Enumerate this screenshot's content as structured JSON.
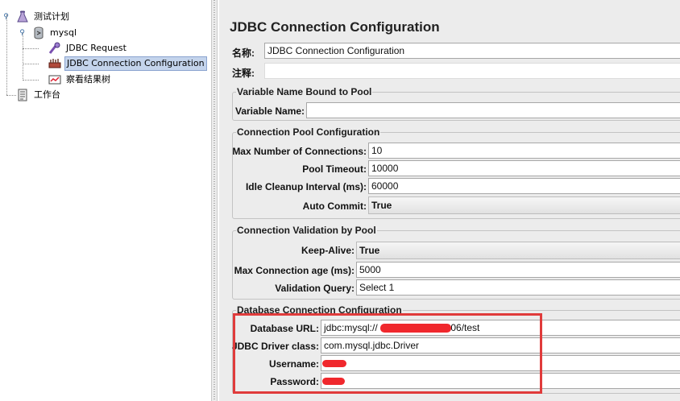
{
  "tree": {
    "items": [
      {
        "label": "测试计划",
        "icon": "test-plan-icon"
      },
      {
        "label": "mysql",
        "icon": "thread-group-icon"
      },
      {
        "label": "JDBC Request",
        "icon": "sampler-icon"
      },
      {
        "label": "JDBC Connection Configuration",
        "icon": "config-element-icon",
        "selected": true
      },
      {
        "label": "察看结果树",
        "icon": "listener-icon"
      },
      {
        "label": "工作台",
        "icon": "workbench-icon"
      }
    ]
  },
  "panel": {
    "title": "JDBC Connection Configuration",
    "name_label": "名称:",
    "name_value": "JDBC Connection Configuration",
    "comment_label": "注释:",
    "comment_value": "",
    "variable_group": {
      "title": "Variable Name Bound to Pool",
      "variable_name_label": "Variable Name:",
      "variable_name_value": ""
    },
    "pool_group": {
      "title": "Connection Pool Configuration",
      "max_connections_label": "Max Number of Connections:",
      "max_connections_value": "10",
      "pool_timeout_label": "Pool Timeout:",
      "pool_timeout_value": "10000",
      "idle_cleanup_label": "Idle Cleanup Interval (ms):",
      "idle_cleanup_value": "60000",
      "auto_commit_label": "Auto Commit:",
      "auto_commit_value": "True"
    },
    "validation_group": {
      "title": "Connection Validation by Pool",
      "keep_alive_label": "Keep-Alive:",
      "keep_alive_value": "True",
      "max_age_label": "Max Connection age (ms):",
      "max_age_value": "5000",
      "validation_query_label": "Validation Query:",
      "validation_query_value": "Select 1"
    },
    "database_group": {
      "title": "Database Connection Configuration",
      "url_label": "Database URL:",
      "url_prefix": "jdbc:mysql://",
      "url_suffix": ":3306/test",
      "driver_label": "JDBC Driver class:",
      "driver_value": "com.mysql.jdbc.Driver",
      "username_label": "Username:",
      "password_label": "Password:"
    }
  },
  "colors": {
    "selection": "#c4d4ec",
    "redaction": "#f0282d",
    "highlight_box": "#e03b3b",
    "panel_bg": "#ececec"
  }
}
